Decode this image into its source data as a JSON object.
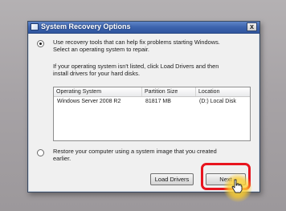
{
  "window": {
    "title": "System Recovery Options",
    "close_glyph": "x"
  },
  "option_repair": {
    "line1": "Use recovery tools that can help fix problems starting Windows.",
    "line2": "Select an operating system to repair.",
    "line3": "If your operating system isn't listed, click Load Drivers and then",
    "line4": "install drivers for your hard disks.",
    "selected": true
  },
  "os_list": {
    "columns": [
      "Operating System",
      "Partition Size",
      "Location"
    ],
    "rows": [
      [
        "Windows Server 2008 R2",
        "81817 MB",
        "(D:) Local Disk"
      ]
    ]
  },
  "option_restore": {
    "line1": "Restore your computer using a system image that you created",
    "line2": "earlier.",
    "selected": false
  },
  "buttons": {
    "load_drivers": "Load Drivers",
    "next": "Next"
  },
  "colors": {
    "titlebar": "#3c63ad",
    "highlight": "#e8141e",
    "cursor_glow": "#ffd23a"
  },
  "icons": {
    "title": "window-icon",
    "close": "close-icon",
    "cursor": "hand-cursor-icon"
  }
}
